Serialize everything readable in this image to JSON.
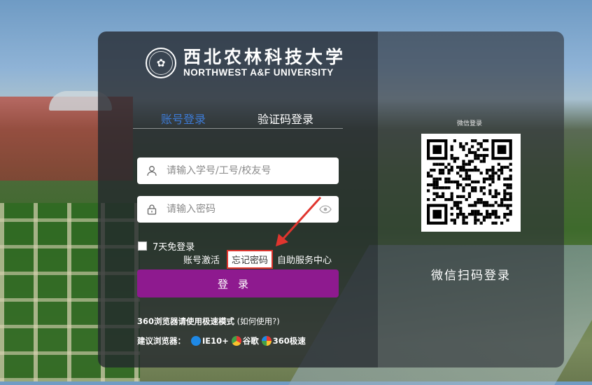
{
  "brand": {
    "name_cn": "西北农林科技大学",
    "name_en": "NORTHWEST A&F UNIVERSITY",
    "seal_glyph": "✿"
  },
  "tabs": [
    {
      "label": "账号登录",
      "active": true
    },
    {
      "label": "验证码登录",
      "active": false
    }
  ],
  "fields": {
    "username_placeholder": "请输入学号/工号/校友号",
    "username_value": "",
    "password_placeholder": "请输入密码",
    "password_value": ""
  },
  "remember_label": "7天免登录",
  "links": {
    "activate": "账号激活",
    "forgot": "忘记密码",
    "self_service": "自助服务中心"
  },
  "login_button": "登录",
  "browser_note": {
    "bold": "360浏览器请使用极速模式",
    "help": "(如何使用?)"
  },
  "suggested": {
    "label": "建议浏览器：",
    "items": [
      "IE10+",
      "谷歌",
      "360极速"
    ]
  },
  "qr": {
    "caption": "微信登录",
    "title": "微信扫码登录"
  },
  "colors": {
    "accent_tab": "#3d7bd6",
    "login_button": "#8e1a8f",
    "highlight_border": "#e0352e"
  },
  "icons": {
    "user": "user-icon",
    "lock": "lock-icon",
    "eye": "eye-icon"
  }
}
